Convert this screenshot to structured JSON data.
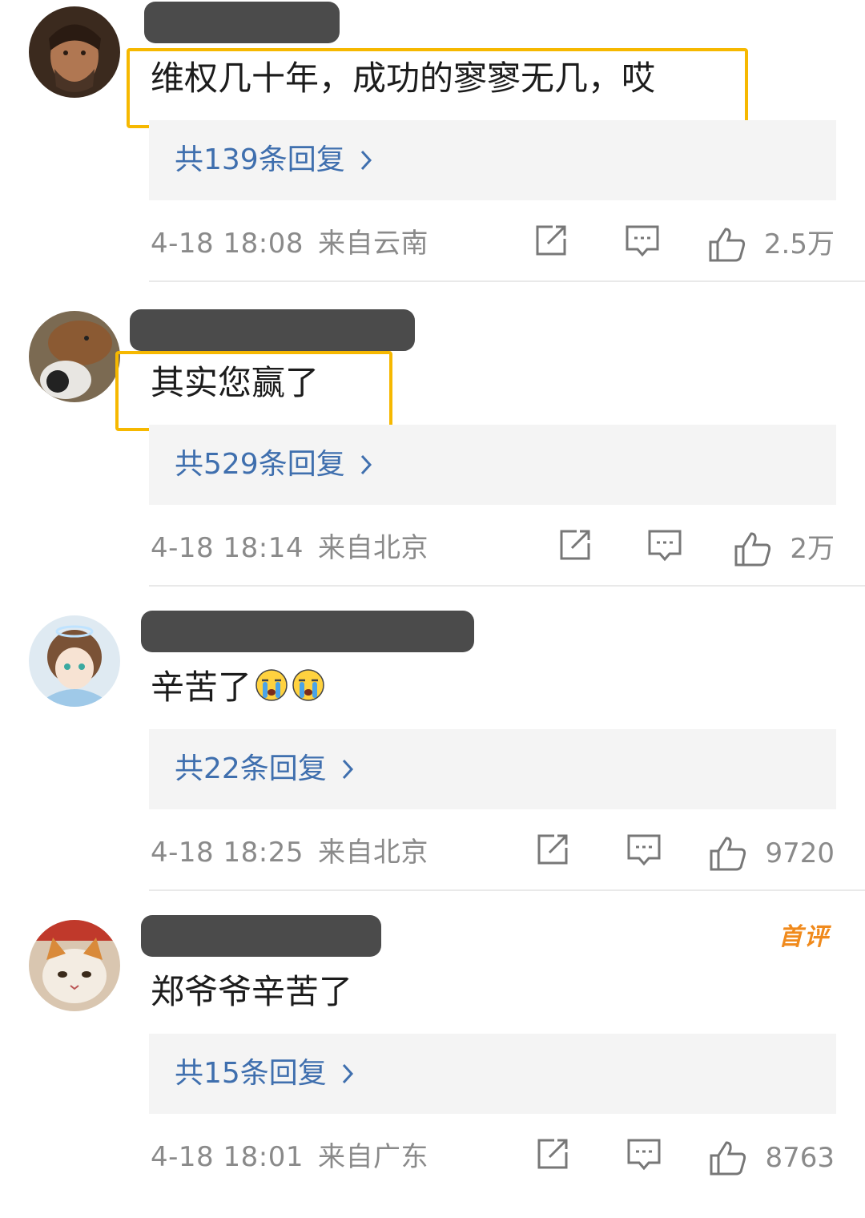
{
  "comments": [
    {
      "text": "维权几十年，成功的寥寥无几，哎",
      "replies": "共139条回复",
      "time": "4-18 18:08",
      "location": "来自云南",
      "likes": "2.5万",
      "avatar_icon": "man-portrait-avatar"
    },
    {
      "text": "其实您赢了",
      "replies": "共529条回复",
      "time": "4-18 18:14",
      "location": "来自北京",
      "likes": "2万",
      "avatar_icon": "capybara-cat-avatar"
    },
    {
      "text": "辛苦了",
      "emoji": [
        "crying-face-emoji",
        "crying-face-emoji"
      ],
      "replies": "共22条回复",
      "time": "4-18 18:25",
      "location": "来自北京",
      "likes": "9720",
      "avatar_icon": "anime-character-avatar"
    },
    {
      "text": "郑爷爷辛苦了",
      "badge": "首评",
      "replies": "共15条回复",
      "time": "4-18 18:01",
      "location": "来自广东",
      "likes": "8763",
      "avatar_icon": "cat-avatar"
    }
  ],
  "colors": {
    "highlight": "#f6b800",
    "reply_link": "#3f6fae",
    "meta": "#8a8a8a",
    "badge": "#f08a1c"
  }
}
